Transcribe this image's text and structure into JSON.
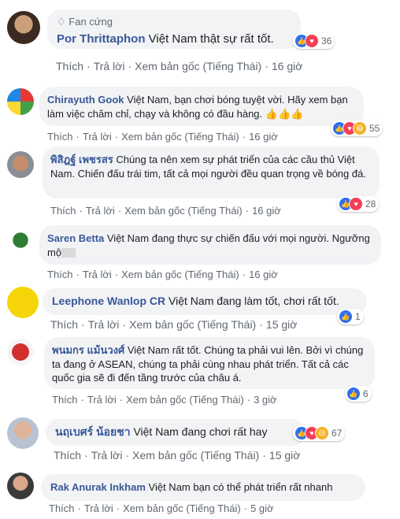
{
  "actions": {
    "like": "Thích",
    "reply": "Trả lời",
    "original": "Xem bản gốc (Tiếng Thái)"
  },
  "comments": [
    {
      "badge": "Fan cứng",
      "name": "Por Thrittaphon",
      "text": "Việt Nam thật sự rất tốt.",
      "time": "16 giờ",
      "reactions": [
        "like",
        "love"
      ],
      "count": "36"
    },
    {
      "name": "Chirayuth Gook",
      "text": "Việt Nam, bạn chơi bóng tuyệt vời. Hãy xem bạn làm việc chăm chỉ, chạy và không có đầu hàng. 👍👍👍",
      "time": "16 giờ",
      "reactions": [
        "like",
        "love",
        "haha"
      ],
      "count": "55"
    },
    {
      "name": "พิสิฎฐ์ เพชรสร",
      "text": "Chúng ta nên xem sự phát triển của các cầu thủ Việt Nam. Chiến đấu trái tim, tất cả mọi người đều quan trọng về bóng đá.",
      "time": "16 giờ",
      "reactions": [
        "like",
        "love"
      ],
      "count": "28"
    },
    {
      "name": "Saren Betta",
      "text": "Việt Nam đang thực sự chiến đấu với mọi người. Ngưỡng mộ",
      "time": "16 giờ"
    },
    {
      "name": "Leephone Wanlop CR",
      "text": "Việt Nam đang làm tốt, chơi rất tốt.",
      "time": "15 giờ",
      "reactions": [
        "like"
      ],
      "count": "1"
    },
    {
      "name": "พนมกร แม้นวงศ์",
      "text": "Việt Nam rất tốt. Chúng ta phải vui lên. Bởi vì chúng ta đang ở ASEAN, chúng ta phải cùng nhau phát triển. Tất cả các quốc gia sẽ đi đến tầng trước của châu á.",
      "time": "3 giờ",
      "reactions": [
        "like"
      ],
      "count": "6"
    },
    {
      "name": "นฤเบศร์ น้อยชา",
      "text": "Việt Nam đang chơi rất hay",
      "time": "15 giờ",
      "reactions": [
        "like",
        "love",
        "sad"
      ],
      "count": "67"
    },
    {
      "name": "Rak Anurak Inkham",
      "text": "Việt Nam bạn có thể phát triển rất nhanh",
      "time": "5 giờ"
    }
  ],
  "colors": {
    "name": "#385898",
    "bubble": "#f2f3f5",
    "like": "#2e6ff2",
    "love": "#f33e58",
    "haha": "#f7b125"
  }
}
